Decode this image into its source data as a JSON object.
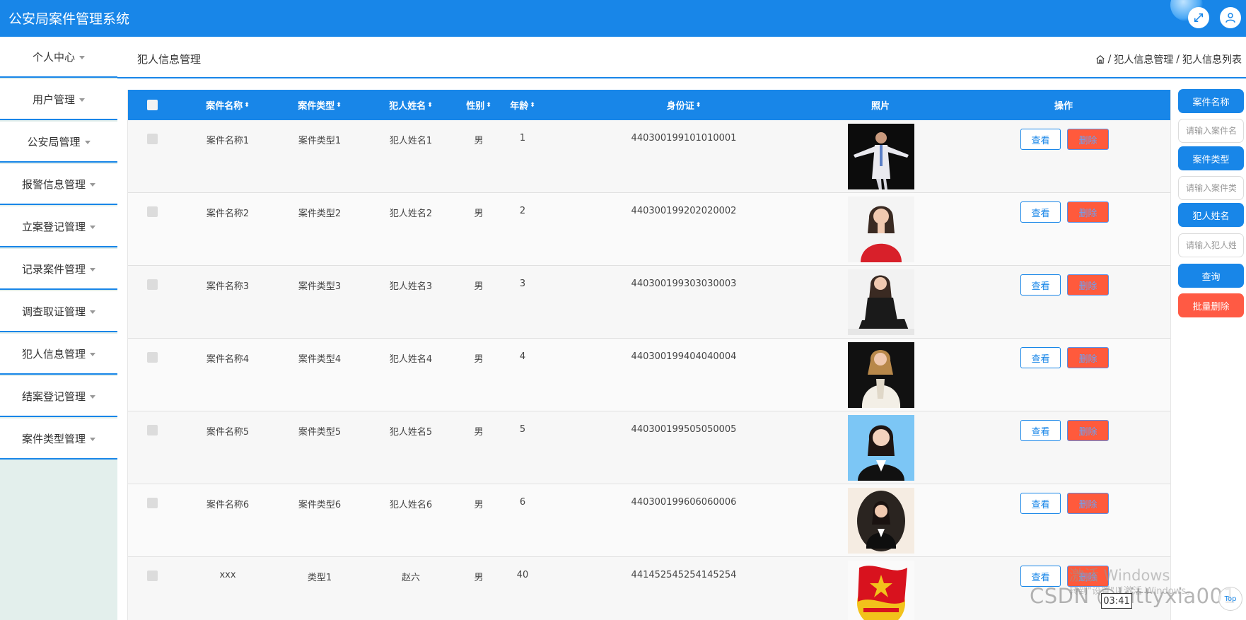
{
  "app": {
    "title": "公安局案件管理系统",
    "brand_color": "#1886e8",
    "danger_color": "#ff5a3c"
  },
  "header_icons": [
    "fullscreen-icon",
    "user-icon"
  ],
  "sidebar": {
    "items": [
      {
        "label": "个人中心"
      },
      {
        "label": "用户管理"
      },
      {
        "label": "公安局管理"
      },
      {
        "label": "报警信息管理"
      },
      {
        "label": "立案登记管理"
      },
      {
        "label": "记录案件管理"
      },
      {
        "label": "调查取证管理"
      },
      {
        "label": "犯人信息管理"
      },
      {
        "label": "结案登记管理"
      },
      {
        "label": "案件类型管理"
      }
    ]
  },
  "page": {
    "title": "犯人信息管理",
    "breadcrumb": [
      "犯人信息管理",
      "犯人信息列表"
    ],
    "breadcrumb_sep": "/"
  },
  "table": {
    "columns": [
      {
        "label": "案件名称",
        "sortable": true
      },
      {
        "label": "案件类型",
        "sortable": true
      },
      {
        "label": "犯人姓名",
        "sortable": true
      },
      {
        "label": "性别",
        "sortable": true
      },
      {
        "label": "年龄",
        "sortable": true
      },
      {
        "label": "身份证",
        "sortable": true
      },
      {
        "label": "照片",
        "sortable": false
      },
      {
        "label": "操作",
        "sortable": false
      }
    ],
    "sort_glyph": "⬍",
    "view_label": "查看",
    "delete_label": "删除",
    "rows": [
      {
        "case_name": "案件名称1",
        "case_type": "案件类型1",
        "name": "犯人姓名1",
        "gender": "男",
        "age": "1",
        "id_card": "440300199101010001",
        "photo": "portrait-man-suit"
      },
      {
        "case_name": "案件名称2",
        "case_type": "案件类型2",
        "name": "犯人姓名2",
        "gender": "男",
        "age": "2",
        "id_card": "440300199202020002",
        "photo": "portrait-woman-red"
      },
      {
        "case_name": "案件名称3",
        "case_type": "案件类型3",
        "name": "犯人姓名3",
        "gender": "男",
        "age": "3",
        "id_card": "440300199303030003",
        "photo": "portrait-woman-seated"
      },
      {
        "case_name": "案件名称4",
        "case_type": "案件类型4",
        "name": "犯人姓名4",
        "gender": "男",
        "age": "4",
        "id_card": "440300199404040004",
        "photo": "portrait-woman-white"
      },
      {
        "case_name": "案件名称5",
        "case_type": "案件类型5",
        "name": "犯人姓名5",
        "gender": "男",
        "age": "5",
        "id_card": "440300199505050005",
        "photo": "portrait-woman-blue-bg"
      },
      {
        "case_name": "案件名称6",
        "case_type": "案件类型6",
        "name": "犯人姓名6",
        "gender": "男",
        "age": "6",
        "id_card": "440300199606060006",
        "photo": "portrait-woman-oval"
      },
      {
        "case_name": "xxx",
        "case_type": "类型1",
        "name": "赵六",
        "gender": "男",
        "age": "40",
        "id_card": "441452545254145254",
        "photo": "emblem-red-flag"
      }
    ]
  },
  "search": {
    "case_name_label": "案件名称",
    "case_name_placeholder": "请输入案件名称",
    "case_type_label": "案件类型",
    "case_type_placeholder": "请输入案件类型",
    "criminal_name_label": "犯人姓名",
    "criminal_name_placeholder": "请输入犯人姓名",
    "query_label": "查询",
    "batch_delete_label": "批量删除"
  },
  "overlay": {
    "activate_text": "激活 Windows",
    "activate_sub": "转到\"设置\"以激活 Windows。",
    "csdn_watermark": "CSDN @kittyxia001",
    "video_time": "03:41",
    "top_label": "Top"
  }
}
